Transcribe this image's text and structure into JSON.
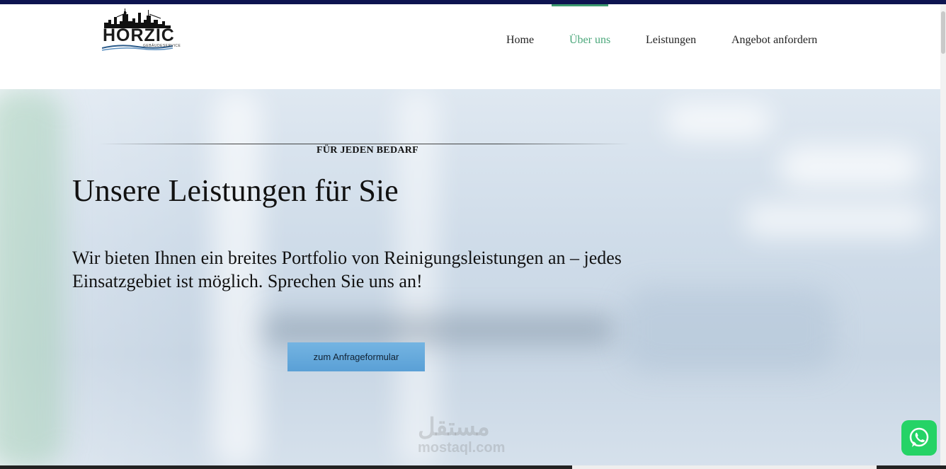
{
  "logo": {
    "brand": "HORZIC",
    "tagline": "GEBÄUDESERVICE",
    "icon": "city-skyline-logo"
  },
  "nav": {
    "items": [
      {
        "label": "Home",
        "active": false
      },
      {
        "label": "Über uns",
        "active": true
      },
      {
        "label": "Leistungen",
        "active": false
      },
      {
        "label": "Angebot anfordern",
        "active": false
      }
    ]
  },
  "hero": {
    "eyebrow": "FÜR JEDEN BEDARF",
    "title": "Unsere Leistungen für Sie",
    "text": "Wir bieten Ihnen ein breites Portfolio von Reinigungsleistungen an – jedes Einsatzgebiet ist möglich. Sprechen Sie uns an!",
    "cta_label": "zum Anfrageformular"
  },
  "watermark": {
    "line1": "مستقل",
    "line2": "mostaql.com"
  },
  "widgets": {
    "whatsapp_icon": "whatsapp-icon"
  },
  "colors": {
    "top_bar": "#0d1450",
    "nav_active": "#4aa77a",
    "cta": "#5aa0d6",
    "whatsapp": "#25d366"
  }
}
